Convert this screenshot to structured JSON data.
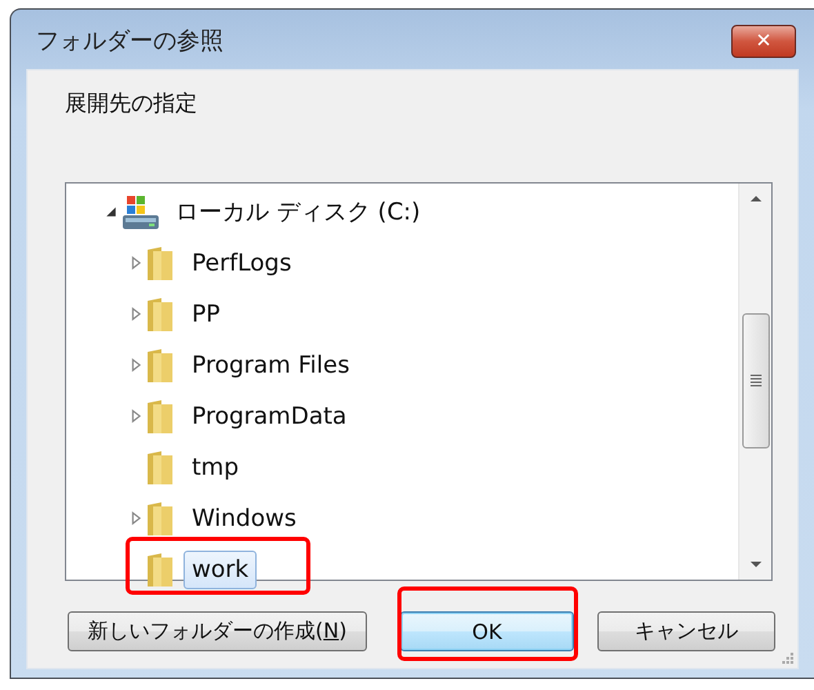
{
  "window": {
    "title": "フォルダーの参照",
    "close_label": "✕"
  },
  "instruction": "展開先の指定",
  "tree": [
    {
      "label": "ローカル ディスク (C:)",
      "kind": "drive",
      "expandable": true,
      "expanded": true,
      "selected": false,
      "highlighted": false,
      "children": [
        {
          "label": "PerfLogs",
          "kind": "folder",
          "expandable": true,
          "expanded": false,
          "selected": false,
          "highlighted": false
        },
        {
          "label": "PP",
          "kind": "folder",
          "expandable": true,
          "expanded": false,
          "selected": false,
          "highlighted": false
        },
        {
          "label": "Program Files",
          "kind": "folder",
          "expandable": true,
          "expanded": false,
          "selected": false,
          "highlighted": false
        },
        {
          "label": "ProgramData",
          "kind": "folder",
          "expandable": true,
          "expanded": false,
          "selected": false,
          "highlighted": false
        },
        {
          "label": "tmp",
          "kind": "folder",
          "expandable": false,
          "selected": false,
          "highlighted": false
        },
        {
          "label": "Windows",
          "kind": "folder",
          "expandable": true,
          "expanded": false,
          "selected": false,
          "highlighted": false
        },
        {
          "label": "work",
          "kind": "folder",
          "expandable": false,
          "selected": true,
          "highlighted": true
        }
      ]
    }
  ],
  "buttons": [
    {
      "label": "新しいフォルダーの作成(**N**)",
      "kind": "new-folder",
      "default": false,
      "highlighted": false
    },
    {
      "label": "OK",
      "kind": "ok",
      "default": true,
      "highlighted": true
    },
    {
      "label": "キャンセル",
      "kind": "cancel",
      "default": false,
      "highlighted": false
    }
  ]
}
